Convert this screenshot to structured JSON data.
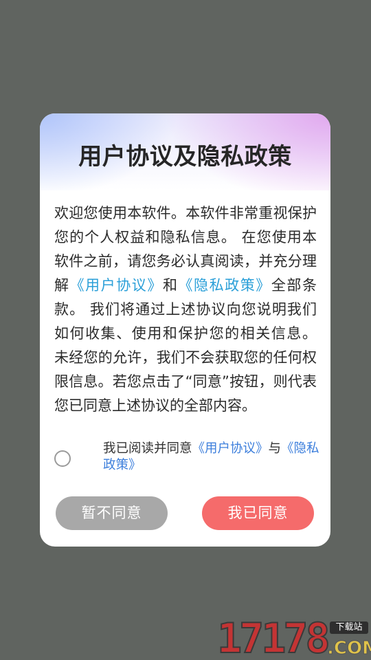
{
  "dialog": {
    "title": "用户协议及隐私政策",
    "body": {
      "text_1": "欢迎您使用本软件。本软件非常重视保护您的个人权益和隐私信息。 在您使用本软件之前，请您务必认真阅读，并充分理解",
      "link_user_agreement": "《用户协议》",
      "text_and": "和",
      "link_privacy_policy": "《隐私政策》",
      "text_2": "全部条款。 我们将通过上述协议向您说明我们如何收集、使用和保护您的相关信息。 未经您的允许，我们不会获取您的任何权限信息。若您点击了“同意”按钮，则代表您已同意上述协议的全部内容。"
    },
    "consent": {
      "checked": false,
      "prefix": "我已阅读并同意",
      "link_user_agreement": "《用户协议》",
      "joiner": "与",
      "link_privacy_policy": "《隐私政策》"
    },
    "buttons": {
      "decline_label": "暂不同意",
      "agree_label": "我已同意"
    },
    "colors": {
      "link": "#2a9fd8",
      "decline_button": "#a8a8a8",
      "agree_button": "#f56b6b",
      "overlay": "#606460"
    }
  },
  "watermark": {
    "number": "17178",
    "badge": "下载站",
    "domain": ".COM"
  }
}
